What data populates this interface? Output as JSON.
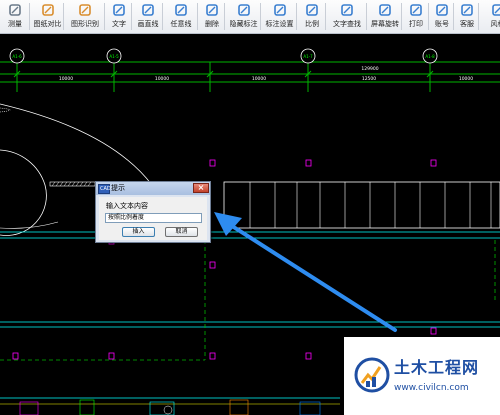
{
  "toolbar": {
    "items": [
      {
        "label": "测量",
        "icon": "measure-icon"
      },
      {
        "label": "图纸对比",
        "icon": "compare-icon"
      },
      {
        "label": "图形识别",
        "icon": "recognize-icon"
      },
      {
        "label": "文字",
        "icon": "text-icon"
      },
      {
        "label": "画直线",
        "icon": "line-icon"
      },
      {
        "label": "任意线",
        "icon": "pencil-icon"
      },
      {
        "label": "删除",
        "icon": "eraser-icon"
      },
      {
        "label": "隐藏标注",
        "icon": "eye-hide-icon"
      },
      {
        "label": "标注设置",
        "icon": "settings-icon"
      },
      {
        "label": "比例",
        "icon": "ruler-icon"
      },
      {
        "label": "文字查找",
        "icon": "text-search-icon"
      },
      {
        "label": "屏幕旋转",
        "icon": "rotate-icon"
      },
      {
        "label": "打印",
        "icon": "print-icon"
      },
      {
        "label": "账号",
        "icon": "user-icon"
      },
      {
        "label": "客服",
        "icon": "headset-icon"
      },
      {
        "label": "风格",
        "icon": "palette-icon"
      }
    ]
  },
  "drawing": {
    "axis_labels": [
      "A1-6",
      "A1-5",
      "A1-7",
      "A1-8"
    ],
    "dimensions": [
      "10000",
      "10000",
      "10000",
      "12500",
      "10000"
    ],
    "total_dimension": "129900",
    "colors": {
      "grid": "#00b400",
      "lines": "#00ffff",
      "markers": "#ff00ff",
      "white": "#ffffff",
      "arrow": "#2e8cf0"
    }
  },
  "dialog": {
    "title": "提示",
    "app_icon_text": "CAD",
    "prompt": "输入文本内容",
    "input_value": "按照比例着度",
    "ok_label": "插入",
    "cancel_label": "取消",
    "close_glyph": "×"
  },
  "watermark": {
    "name": "土木工程网",
    "url": "www.civilcn.com"
  }
}
